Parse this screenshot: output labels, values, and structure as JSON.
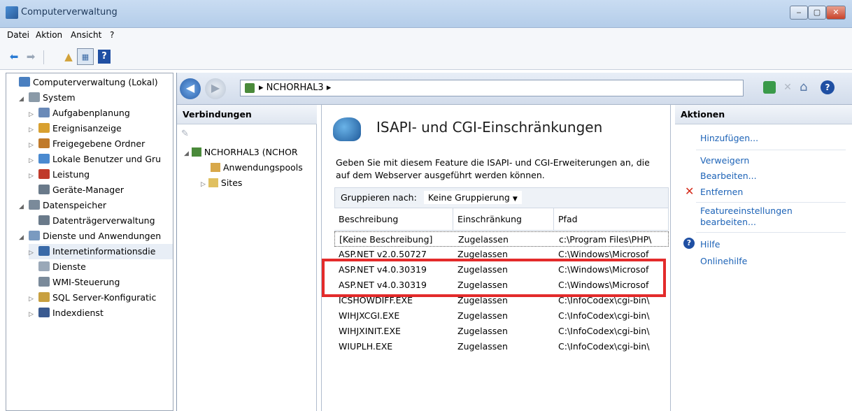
{
  "window": {
    "title": "Computerverwaltung",
    "min": "‒",
    "max": "▢",
    "close": "✕"
  },
  "menu": [
    "Datei",
    "Aktion",
    "Ansicht",
    "?"
  ],
  "tree": [
    {
      "label": "Computerverwaltung (Lokal)",
      "level": 0,
      "expander": ""
    },
    {
      "label": "System",
      "level": 1,
      "expander": "◢"
    },
    {
      "label": "Aufgabenplanung",
      "level": 2,
      "expander": "▷"
    },
    {
      "label": "Ereignisanzeige",
      "level": 2,
      "expander": "▷"
    },
    {
      "label": "Freigegebene Ordner",
      "level": 2,
      "expander": "▷"
    },
    {
      "label": "Lokale Benutzer und Gru",
      "level": 2,
      "expander": "▷"
    },
    {
      "label": "Leistung",
      "level": 2,
      "expander": "▷"
    },
    {
      "label": "Geräte-Manager",
      "level": 2,
      "expander": ""
    },
    {
      "label": "Datenspeicher",
      "level": 1,
      "expander": "◢"
    },
    {
      "label": "Datenträgerverwaltung",
      "level": 2,
      "expander": ""
    },
    {
      "label": "Dienste und Anwendungen",
      "level": 1,
      "expander": "◢"
    },
    {
      "label": "Internetinformationsdie",
      "level": 2,
      "expander": "▷"
    },
    {
      "label": "Dienste",
      "level": 2,
      "expander": ""
    },
    {
      "label": "WMI-Steuerung",
      "level": 2,
      "expander": ""
    },
    {
      "label": "SQL Server-Konfiguratic",
      "level": 2,
      "expander": "▷"
    },
    {
      "label": "Indexdienst",
      "level": 2,
      "expander": "▷"
    }
  ],
  "nav": {
    "address": "▸  NCHORHAL3  ▸"
  },
  "connections": {
    "title": "Verbindungen",
    "server": "NCHORHAL3 (NCHOR",
    "app_pools": "Anwendungspools",
    "sites": "Sites"
  },
  "feature": {
    "title": "ISAPI- und CGI-Einschränkungen",
    "description": "Geben Sie mit diesem Feature die ISAPI- und CGI-Erweiterungen an, die auf dem Webserver ausgeführt werden können.",
    "group_label": "Gruppieren nach:",
    "group_value": "Keine Gruppierung",
    "columns": [
      "Beschreibung",
      "Einschränkung",
      "Pfad"
    ],
    "rows": [
      [
        "[Keine Beschreibung]",
        "Zugelassen",
        "c:\\Program Files\\PHP\\"
      ],
      [
        "ASP.NET v2.0.50727",
        "Zugelassen",
        "C:\\Windows\\Microsof"
      ],
      [
        "ASP.NET v4.0.30319",
        "Zugelassen",
        "C:\\Windows\\Microsof"
      ],
      [
        "ASP.NET v4.0.30319",
        "Zugelassen",
        "C:\\Windows\\Microsof"
      ],
      [
        "ICSHOWDIFF.EXE",
        "Zugelassen",
        "C:\\InfoCodex\\cgi-bin\\"
      ],
      [
        "WIHJXCGI.EXE",
        "Zugelassen",
        "C:\\InfoCodex\\cgi-bin\\"
      ],
      [
        "WIHJXINIT.EXE",
        "Zugelassen",
        "C:\\InfoCodex\\cgi-bin\\"
      ],
      [
        "WIUPLH.EXE",
        "Zugelassen",
        "C:\\InfoCodex\\cgi-bin\\"
      ]
    ]
  },
  "actions": {
    "title": "Aktionen",
    "add": "Hinzufügen...",
    "deny": "Verweigern",
    "edit": "Bearbeiten...",
    "remove": "Entfernen",
    "feature_settings": "Featureeinstellungen bearbeiten...",
    "help": "Hilfe",
    "online_help": "Onlinehilfe"
  },
  "colors": {
    "highlight": "#e32b2b",
    "link": "#1d63b7"
  }
}
